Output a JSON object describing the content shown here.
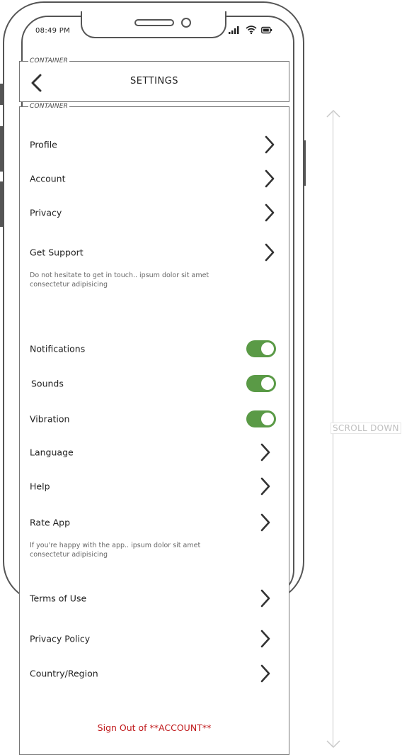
{
  "status_bar": {
    "time": "08:49 PM"
  },
  "header": {
    "container_label": "CONTAINER",
    "title": "SETTINGS"
  },
  "content": {
    "container_label": "CONTAINER",
    "items": [
      {
        "label": "Profile"
      },
      {
        "label": "Account"
      },
      {
        "label": "Privacy"
      },
      {
        "label": "Get Support",
        "description": "Do not hesitate to get in touch.. ipsum dolor sit amet consectetur adipisicing"
      },
      {
        "label": "Notifications",
        "toggle": true
      },
      {
        "label": "Sounds",
        "toggle": true
      },
      {
        "label": "Vibration",
        "toggle": true
      },
      {
        "label": "Language"
      },
      {
        "label": "Help"
      },
      {
        "label": "Rate App",
        "description": "If you're happy with the app.. ipsum dolor sit amet consectetur adipisicing"
      },
      {
        "label": "Terms of Use"
      },
      {
        "label": "Privacy Policy"
      },
      {
        "label": "Country/Region"
      }
    ],
    "sign_out": "Sign Out of **ACCOUNT**"
  },
  "scroll_hint": "SCROLL DOWN",
  "colors": {
    "toggle_on": "#5a9a46",
    "sign_out": "#c0191b"
  }
}
